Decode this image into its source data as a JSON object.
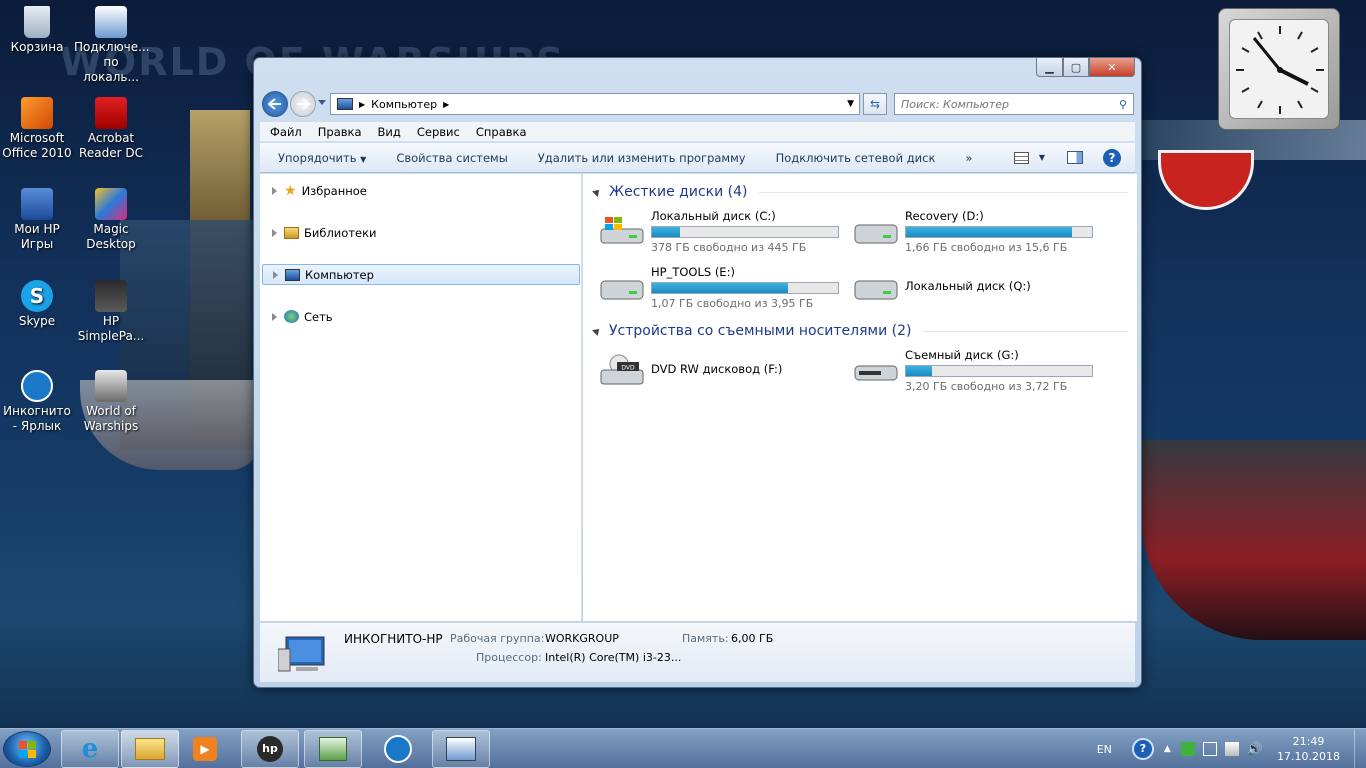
{
  "desktop": {
    "icons": [
      {
        "label": "Корзина"
      },
      {
        "label": "Подключе... по локаль..."
      },
      {
        "label": "Microsoft Office 2010"
      },
      {
        "label": "Acrobat Reader DC"
      },
      {
        "label": "Мои HP Игры"
      },
      {
        "label": "Magic Desktop"
      },
      {
        "label": "Skype"
      },
      {
        "label": "HP SimplePa..."
      },
      {
        "label": "Инкогнито - Ярлык"
      },
      {
        "label": "World of Warships"
      }
    ],
    "wallpaper_text": "WORLD OF WARSHIPS"
  },
  "window": {
    "address": {
      "icon": "computer-icon",
      "crumb": "Компьютер"
    },
    "search": {
      "placeholder": "Поиск: Компьютер"
    },
    "menu": [
      "Файл",
      "Правка",
      "Вид",
      "Сервис",
      "Справка"
    ],
    "commands": [
      "Упорядочить",
      "Свойства системы",
      "Удалить или изменить программу",
      "Подключить сетевой диск",
      "»"
    ],
    "nav": [
      {
        "label": "Избранное",
        "icon": "star-icon"
      },
      {
        "label": "Библиотеки",
        "icon": "library-icon"
      },
      {
        "label": "Компьютер",
        "icon": "computer-icon",
        "selected": true
      },
      {
        "label": "Сеть",
        "icon": "network-icon"
      }
    ],
    "groups": {
      "hdd": {
        "title": "Жесткие диски (4)"
      },
      "removable": {
        "title": "Устройства со съемными носителями (2)"
      }
    },
    "drives": [
      {
        "name": "Локальный диск (C:)",
        "free": "378 ГБ свободно из 445 ГБ",
        "used_fraction": 0.15,
        "icon": "windows-drive-icon"
      },
      {
        "name": "Recovery (D:)",
        "free": "1,66 ГБ свободно из 15,6 ГБ",
        "used_fraction": 0.89,
        "icon": "hard-drive-icon"
      },
      {
        "name": "HP_TOOLS (E:)",
        "free": "1,07 ГБ свободно из 3,95 ГБ",
        "used_fraction": 0.73,
        "icon": "hard-drive-icon"
      },
      {
        "name": "Локальный диск (Q:)",
        "icon": "hard-drive-icon"
      },
      {
        "name": "DVD RW дисковод (F:)",
        "icon": "dvd-drive-icon"
      },
      {
        "name": "Съемный диск (G:)",
        "free": "3,20 ГБ свободно из 3,72 ГБ",
        "used_fraction": 0.14,
        "icon": "removable-drive-icon"
      }
    ],
    "details": {
      "computer_name": "ИНКОГНИТО-HP",
      "workgroup_label": "Рабочая группа:",
      "workgroup": "WORKGROUP",
      "memory_label": "Память:",
      "memory": "6,00 ГБ",
      "cpu_label": "Процессор:",
      "cpu": "Intel(R) Core(TM) i3-23..."
    }
  },
  "taskbar": {
    "language": "EN",
    "time": "21:49",
    "date": "17.10.2018"
  },
  "colors": {
    "accent": "#1e3a8a",
    "bar": "#1a88c4",
    "selection": "#d6e8fb"
  }
}
